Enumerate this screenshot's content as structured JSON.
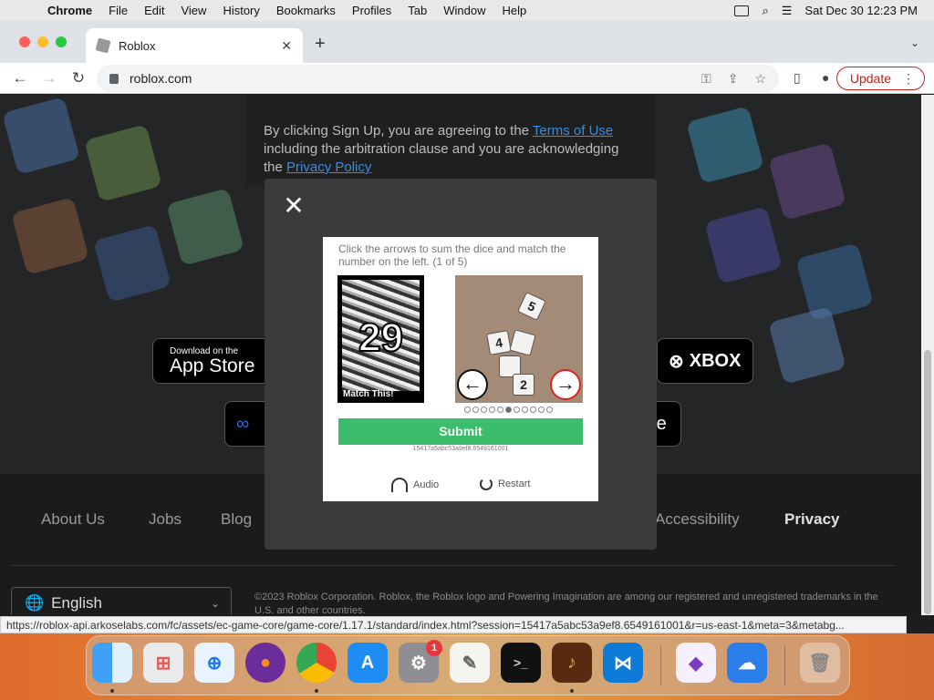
{
  "menubar": {
    "app_name": "Chrome",
    "items": [
      "File",
      "Edit",
      "View",
      "History",
      "Bookmarks",
      "Profiles",
      "Tab",
      "Window",
      "Help"
    ],
    "datetime": "Sat Dec 30  12:23 PM"
  },
  "browser": {
    "tab_title": "Roblox",
    "url": "roblox.com",
    "update_label": "Update",
    "status_url": "https://roblox-api.arkoselabs.com/fc/assets/ec-game-core/game-core/1.17.1/standard/index.html?session=15417a5abc53a9ef8.6549161001&r=us-east-1&meta=3&metabg..."
  },
  "page": {
    "terms": {
      "prefix": "By clicking Sign Up, you are agreeing to the ",
      "terms_link": "Terms of Use",
      "middle": " including the arbitration clause and you are acknowledging the ",
      "privacy_link": "Privacy Policy"
    },
    "store_buttons": {
      "appstore_small": "Download on the",
      "appstore_big": "App Store",
      "xbox": "XBOX",
      "meta": "∞",
      "store2": "re"
    },
    "footer_links": [
      "About Us",
      "Jobs",
      "Blog",
      "Accessibility",
      "Privacy"
    ],
    "language": "English",
    "copyright": "©2023 Roblox Corporation. Roblox, the Roblox logo and Powering Imagination are among our registered and unregistered trademarks in the U.S. and other countries."
  },
  "captcha": {
    "instructions": "Click the arrows to sum the dice and match the number on the left. (1 of 5)",
    "target_number": "29",
    "target_label": "Match This!",
    "dice_faces": [
      "5",
      "4",
      "2"
    ],
    "progress": {
      "current_index": 5,
      "total": 11
    },
    "submit_label": "Submit",
    "session_id": "15417a5abc53a9ef8.6549161001",
    "audio_label": "Audio",
    "restart_label": "Restart"
  },
  "dock": {
    "apps": [
      "Finder",
      "Launchpad",
      "Safari",
      "Firefox",
      "Chrome",
      "App Store",
      "System Preferences",
      "TextEdit",
      "Terminal",
      "Instruments",
      "VS Code",
      "Visual Studio",
      "Weather",
      "Trash"
    ],
    "settings_badge": "1"
  }
}
